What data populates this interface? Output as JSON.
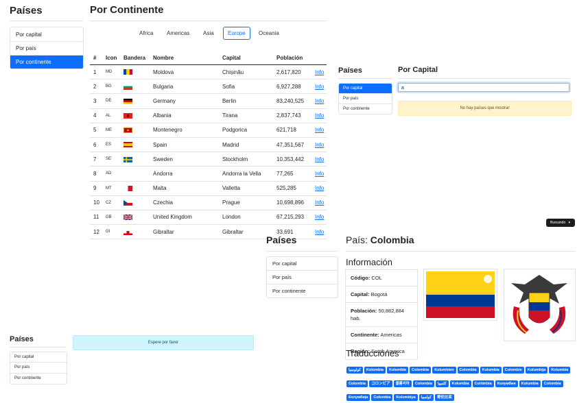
{
  "panel1": {
    "sidebar_title": "Países",
    "nav": [
      "Por capital",
      "Por país",
      "Por continente"
    ],
    "title": "Por Continente",
    "regions": [
      "Africa",
      "Americas",
      "Asia",
      "Europe",
      "Oceania"
    ],
    "selected_region": "Europe",
    "table_headers": [
      "#",
      "Icon",
      "Bandera",
      "Nombre",
      "Capital",
      "Población"
    ],
    "rows": [
      {
        "n": "1",
        "code": "MD",
        "name": "Moldova",
        "capital": "Chișinău",
        "pop": "2,617,820",
        "info": "Info"
      },
      {
        "n": "2",
        "code": "BG",
        "name": "Bulgaria",
        "capital": "Sofia",
        "pop": "6,927,288",
        "info": "Info"
      },
      {
        "n": "3",
        "code": "DE",
        "name": "Germany",
        "capital": "Berlin",
        "pop": "83,240,525",
        "info": "Info"
      },
      {
        "n": "4",
        "code": "AL",
        "name": "Albania",
        "capital": "Tirana",
        "pop": "2,837,743",
        "info": "Info"
      },
      {
        "n": "5",
        "code": "ME",
        "name": "Montenegro",
        "capital": "Podgorica",
        "pop": "621,718",
        "info": "Info"
      },
      {
        "n": "6",
        "code": "ES",
        "name": "Spain",
        "capital": "Madrid",
        "pop": "47,351,567",
        "info": "Info"
      },
      {
        "n": "7",
        "code": "SE",
        "name": "Sweden",
        "capital": "Stockholm",
        "pop": "10,353,442",
        "info": "Info"
      },
      {
        "n": "8",
        "code": "AD",
        "name": "Andorra",
        "capital": "Andorra la Vella",
        "pop": "77,265",
        "info": "Info"
      },
      {
        "n": "9",
        "code": "MT",
        "name": "Malta",
        "capital": "Valletta",
        "pop": "525,285",
        "info": "Info"
      },
      {
        "n": "10",
        "code": "CZ",
        "name": "Czechia",
        "capital": "Prague",
        "pop": "10,698,896",
        "info": "Info"
      },
      {
        "n": "11",
        "code": "GB",
        "name": "United Kingdom",
        "capital": "London",
        "pop": "67,215,293",
        "info": "Info"
      },
      {
        "n": "12",
        "code": "GI",
        "name": "Gibraltar",
        "capital": "Gibraltar",
        "pop": "33,691",
        "info": "Info"
      }
    ]
  },
  "panel2": {
    "sidebar_title": "Países",
    "nav": [
      "Por capital",
      "Por país",
      "Por continente"
    ],
    "title": "Por Capital",
    "search_value": "a",
    "alert": "No hay países que mostrar",
    "toast": "Buscando",
    "toast_arrow": "▾"
  },
  "panel3": {
    "sidebar_title": "Países",
    "nav": [
      "Por capital",
      "Por país",
      "Por continente"
    ],
    "title_prefix": "País:",
    "country": "Colombia",
    "info_heading": "Información",
    "info": {
      "code_label": "Código:",
      "code": "COL",
      "capital_label": "Capital:",
      "capital": "Bogotá",
      "population_label": "Población:",
      "population": "50,882,884 hab.",
      "continent_label": "Continente:",
      "continent": "Americas",
      "region_label": "Región:",
      "region": "South America"
    },
    "translations_heading": "Traducciones",
    "translations": [
      "كولومبيا",
      "Kolombia",
      "Kolumbie",
      "Colombia",
      "Kolumbien",
      "Colombia",
      "Kolumbia",
      "Colombie",
      "Kolumbija",
      "Kolumbia",
      "Colombia",
      "コロンビア",
      "콜롬비아",
      "Colombia",
      "کلمبیا",
      "Kolumbia",
      "Colômbia",
      "Колумбия",
      "Kolumbia",
      "Colombia",
      "Колумбија",
      "Colombia",
      "Kolombiya",
      "كولمبيا",
      "哥伦比亚"
    ]
  },
  "panel4": {
    "sidebar_title": "Países",
    "nav": [
      "Por capital",
      "Por país",
      "Por continente"
    ],
    "loading": "Espere por favor"
  },
  "colors": {
    "primary": "#0d6efd",
    "warning_bg": "#fff3cd",
    "info_bg": "#cff4fc",
    "border": "#dee2e6"
  }
}
